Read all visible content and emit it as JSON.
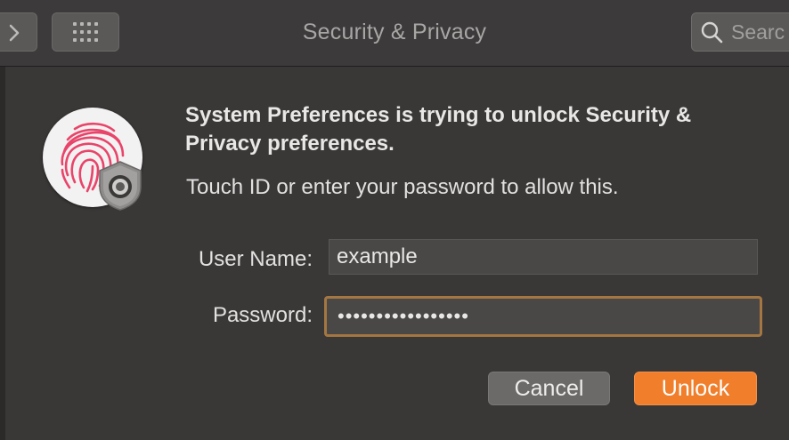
{
  "window": {
    "title": "Security & Privacy"
  },
  "toolbar": {
    "forward_icon": "chevron-right-icon",
    "grid_icon": "grid-icon"
  },
  "search": {
    "placeholder": "Search",
    "icon": "search-icon"
  },
  "dialog": {
    "heading": "System Preferences is trying to unlock Security & Privacy preferences.",
    "subtext": "Touch ID or enter your password to allow this.",
    "icon": "touch-id-fingerprint-icon",
    "badge_icon": "lock-icon",
    "username_label": "User Name:",
    "username_value": "example",
    "password_label": "Password:",
    "password_value": "•••••••••••••••••",
    "cancel_label": "Cancel",
    "unlock_label": "Unlock"
  },
  "colors": {
    "accent": "#f07e2b",
    "focus_ring": "#a37642",
    "fingerprint": "#e9446a"
  }
}
